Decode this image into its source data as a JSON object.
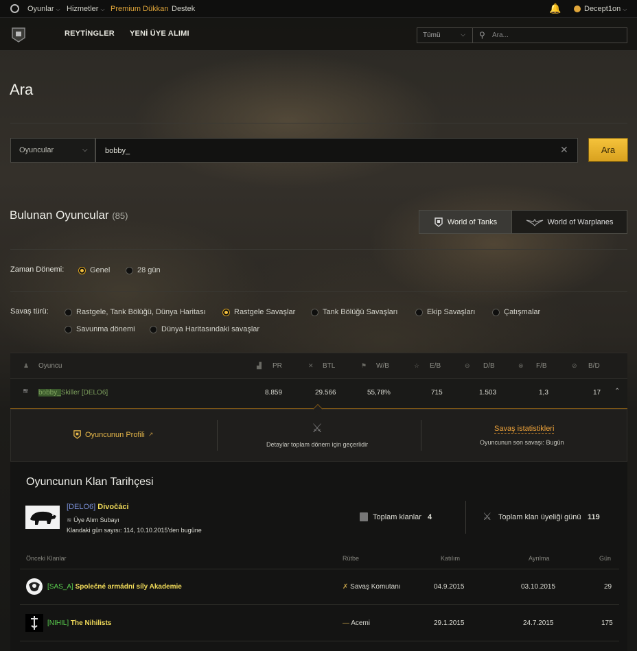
{
  "topbar": {
    "games": "Oyunlar",
    "services": "Hizmetler",
    "premium": "Premium Dükkan",
    "support": "Destek",
    "user": "Decept1on"
  },
  "header": {
    "nav": [
      "REYTİNGLER",
      "YENİ ÜYE ALIMI"
    ],
    "select_value": "Tümü",
    "search_placeholder": "Ara..."
  },
  "page": {
    "title": "Ara",
    "search_category": "Oyuncular",
    "search_value": "bobby_",
    "search_button": "Ara"
  },
  "results": {
    "title": "Bulunan Oyuncular",
    "count": "(85)",
    "game_tabs": [
      "World of Tanks",
      "World of Warplanes"
    ],
    "active_tab": "World of Tanks"
  },
  "period": {
    "label": "Zaman Dönemi:",
    "options": [
      "Genel",
      "28 gün"
    ],
    "selected": "Genel"
  },
  "battle_type": {
    "label": "Savaş türü:",
    "options": [
      "Rastgele, Tank Bölüğü, Dünya Haritası",
      "Rastgele Savaşlar",
      "Tank Bölüğü Savaşları",
      "Ekip Savaşları",
      "Çatışmalar",
      "Savunma dönemi",
      "Dünya Haritasındaki savaşlar"
    ],
    "selected": "Rastgele Savaşlar"
  },
  "table": {
    "columns": [
      "Oyuncu",
      "PR",
      "BTL",
      "W/B",
      "E/B",
      "D/B",
      "F/B",
      "B/D"
    ],
    "row": {
      "highlight": "bobby_",
      "rest": "Skiller [DELO6]",
      "values": [
        "8.859",
        "29.566",
        "55,78%",
        "715",
        "1.503",
        "1,3",
        "17"
      ]
    }
  },
  "detail": {
    "profile": "Oyuncunun Profili",
    "details_note": "Detaylar toplam dönem için geçerlidir",
    "stats_link": "Savaş istatistikleri",
    "last_battle": "Oyuncunun son savaşı: Bugün"
  },
  "clan": {
    "title": "Oyuncunun Klan Tarihçesi",
    "current_tag": "[DELO6]",
    "current_name": "Divočáci",
    "role": "Üye Alım Subayı",
    "days_text": "Klandaki gün sayısı: 114, 10.10.2015'den bugüne",
    "total_clans_label": "Toplam klanlar",
    "total_clans": "4",
    "total_days_label": "Toplam klan üyeliği günü",
    "total_days": "119",
    "prev_headers": [
      "Önceki Klanlar",
      "Rütbe",
      "Katılım",
      "Ayrılma",
      "Gün"
    ],
    "previous": [
      {
        "tag": "[SAS_A]",
        "name": "Společné armádní síly Akademie",
        "rank": "Savaş Komutanı",
        "joined": "04.9.2015",
        "left": "03.10.2015",
        "days": "29"
      },
      {
        "tag": "[NIHIL]",
        "name": "The Nihilists",
        "rank": "Acemi",
        "joined": "29.1.2015",
        "left": "24.7.2015",
        "days": "175"
      }
    ]
  },
  "colors": {
    "accent": "#f2c040",
    "premium": "#e0a63a",
    "clan_tag": "#5bd04f"
  }
}
